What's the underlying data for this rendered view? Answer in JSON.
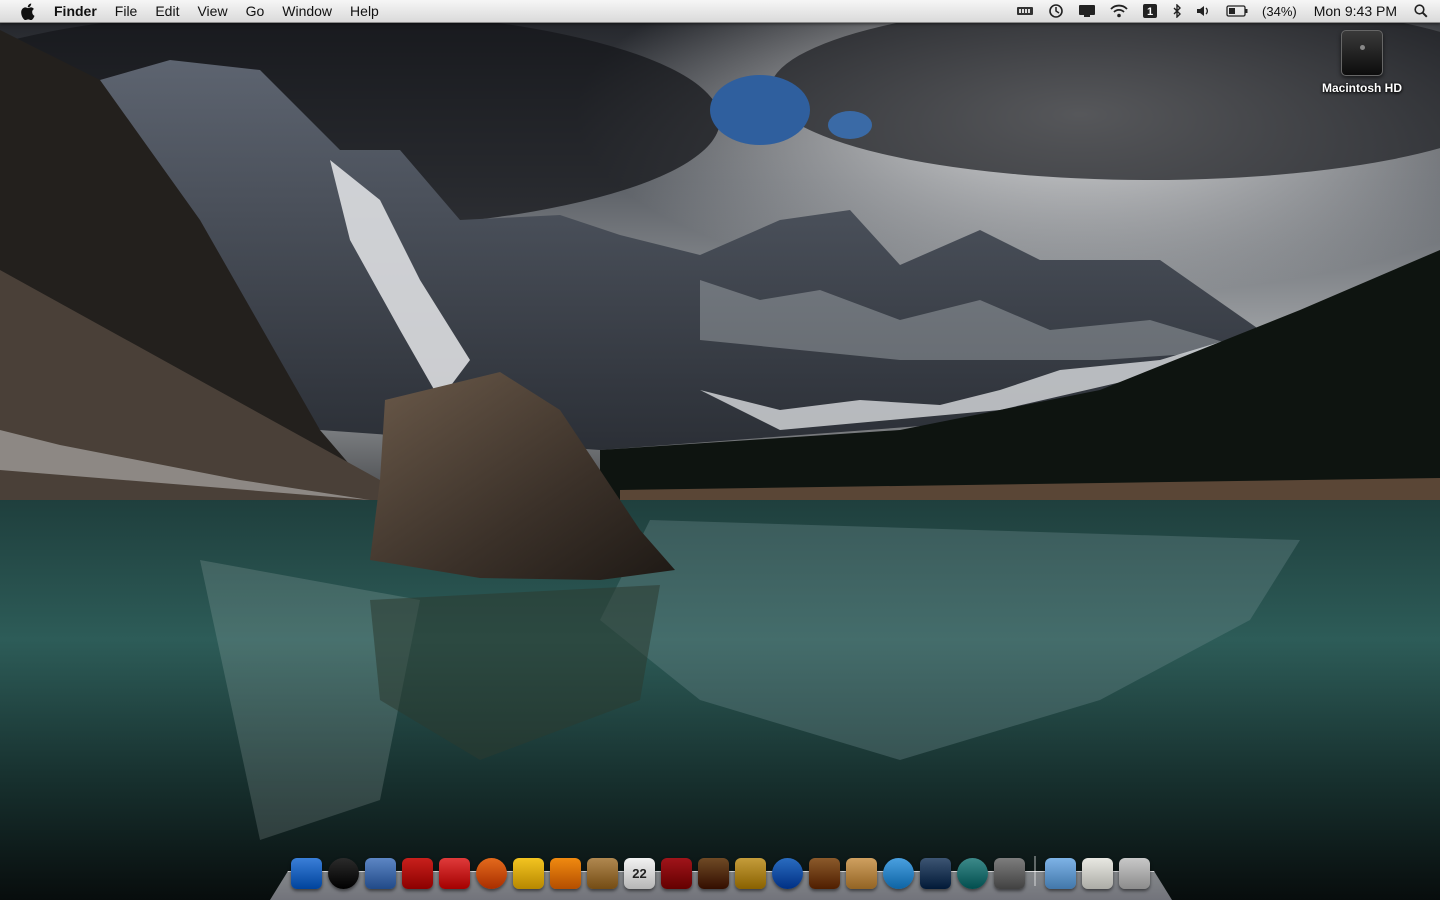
{
  "menubar": {
    "app_name": "Finder",
    "items": [
      "File",
      "Edit",
      "View",
      "Go",
      "Window",
      "Help"
    ],
    "battery_percent": "(34%)",
    "clock": "Mon 9:43 PM"
  },
  "desktop": {
    "icons": [
      {
        "label": "Macintosh HD",
        "icon": "hard-drive-icon"
      }
    ]
  },
  "dock": {
    "apps": [
      {
        "name": "finder-icon",
        "color": "#3a7fd8"
      },
      {
        "name": "dashboard-icon",
        "color": "#2b2b2b"
      },
      {
        "name": "mail-icon",
        "color": "#5d86c4"
      },
      {
        "name": "chair-app-icon",
        "color": "#c8201c"
      },
      {
        "name": "adium-like-icon",
        "color": "#e03a3a"
      },
      {
        "name": "firefox-icon",
        "color": "#e46a1c"
      },
      {
        "name": "adium-duck-icon",
        "color": "#f3c421"
      },
      {
        "name": "vlc-icon",
        "color": "#f08a10"
      },
      {
        "name": "address-book-icon",
        "color": "#b08850"
      },
      {
        "name": "ical-icon",
        "color": "#f2f2f2",
        "text": "22"
      },
      {
        "name": "photo-booth-icon",
        "color": "#a0141a"
      },
      {
        "name": "iphoto-icon",
        "color": "#6f4a25"
      },
      {
        "name": "imovie-star-icon",
        "color": "#c59d3b"
      },
      {
        "name": "dvd-player-icon",
        "color": "#2a6cc0"
      },
      {
        "name": "garageband-icon",
        "color": "#8b5a2b"
      },
      {
        "name": "preview-icon",
        "color": "#cfa060"
      },
      {
        "name": "itunes-icon",
        "color": "#4aa0e0"
      },
      {
        "name": "spaces-icon",
        "color": "#3d5573"
      },
      {
        "name": "time-machine-icon",
        "color": "#3d8a8a"
      },
      {
        "name": "system-preferences-icon",
        "color": "#7d7d7d"
      }
    ],
    "folders": [
      {
        "name": "applications-folder-icon",
        "color": "#7eb3e6"
      },
      {
        "name": "documents-stack-icon",
        "color": "#e8e8e2"
      },
      {
        "name": "trash-icon",
        "color": "#c8c8c8"
      }
    ]
  }
}
